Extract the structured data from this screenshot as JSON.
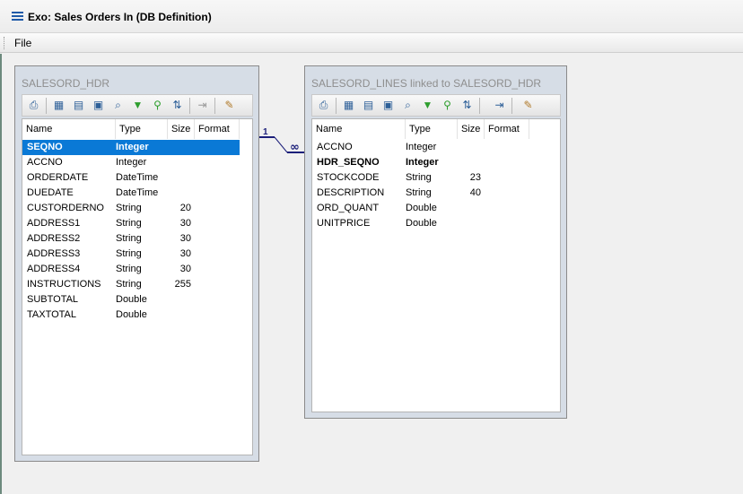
{
  "window": {
    "title": "Exo: Sales Orders In (DB Definition)",
    "icon": "list-icon"
  },
  "menubar": {
    "file": "File"
  },
  "relationship": {
    "one_label": "1",
    "many_label": "∞"
  },
  "header_table": {
    "title": "SALESORD_HDR",
    "columns": [
      "Name",
      "Type",
      "Size",
      "Format"
    ],
    "rows": [
      {
        "name": "SEQNO",
        "type": "Integer",
        "size": "",
        "selected": true
      },
      {
        "name": "ACCNO",
        "type": "Integer",
        "size": ""
      },
      {
        "name": "ORDERDATE",
        "type": "DateTime",
        "size": ""
      },
      {
        "name": "DUEDATE",
        "type": "DateTime",
        "size": ""
      },
      {
        "name": "CUSTORDERNO",
        "type": "String",
        "size": "20"
      },
      {
        "name": "ADDRESS1",
        "type": "String",
        "size": "30"
      },
      {
        "name": "ADDRESS2",
        "type": "String",
        "size": "30"
      },
      {
        "name": "ADDRESS3",
        "type": "String",
        "size": "30"
      },
      {
        "name": "ADDRESS4",
        "type": "String",
        "size": "30"
      },
      {
        "name": "INSTRUCTIONS",
        "type": "String",
        "size": "255"
      },
      {
        "name": "SUBTOTAL",
        "type": "Double",
        "size": ""
      },
      {
        "name": "TAXTOTAL",
        "type": "Double",
        "size": ""
      }
    ]
  },
  "lines_table": {
    "title": "SALESORD_LINES linked to SALESORD_HDR",
    "columns": [
      "Name",
      "Type",
      "Size",
      "Format"
    ],
    "rows": [
      {
        "name": "ACCNO",
        "type": "Integer",
        "size": ""
      },
      {
        "name": "HDR_SEQNO",
        "type": "Integer",
        "size": "",
        "bold": true
      },
      {
        "name": "STOCKCODE",
        "type": "String",
        "size": "23"
      },
      {
        "name": "DESCRIPTION",
        "type": "String",
        "size": "40"
      },
      {
        "name": "ORD_QUANT",
        "type": "Double",
        "size": ""
      },
      {
        "name": "UNITPRICE",
        "type": "Double",
        "size": ""
      }
    ]
  },
  "toolbar_icons": [
    "preview-icon",
    "grid-icon",
    "form-icon",
    "calculator-icon",
    "search-icon",
    "filter-icon",
    "filter-search-icon",
    "sort-icon",
    "import-icon",
    "edit-notes-icon"
  ],
  "colors": {
    "selection": "#0a79d6",
    "link_line": "#1c1f7a",
    "panel": "#d6dde6"
  }
}
